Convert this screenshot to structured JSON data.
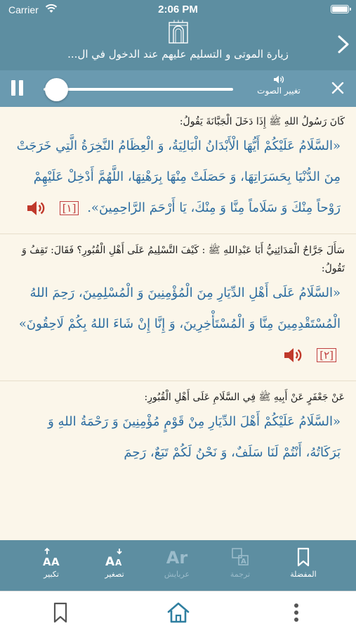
{
  "status": {
    "carrier": "Carrier",
    "time": "2:06 PM"
  },
  "header": {
    "title": "زيارة الموتى و التسليم عليهم عند الدخول في ال..."
  },
  "audio": {
    "volume_label": "تغيير الصوت",
    "progress": 0.07
  },
  "sections": [
    {
      "intro": "كَانَ رَسُولُ اللهِ ﷺ إِذَا دَخَلَ الْجَبَّانَةَ يَقُولُ:",
      "prayer": "«السَّلَامُ عَلَيْكُمْ أَيُّهَا الْأَبْدَانُ الْبَالِيَةُ، وَ الْعِظَامُ النَّخِرَةُ الَّتِي خَرَجَتْ مِنَ الدُّنْيَا بِحَسَرَاتِهَا، وَ حَصَلَتْ مِنْهَا بِرَهْنِهَا، اللَّهُمَّ أَدْخِلْ عَلَيْهِمْ رَوْحاً مِنْكَ وَ سَلَاماً مِنَّا وَ مِنْكَ، يَا أَرْحَمَ الرَّاحِمِينَ».",
      "ref": "[١]"
    },
    {
      "intro": "سَأَلَ جَرَّاحٌ الْمَدَائِنِيُّ أَبَا عَبْدِاللهِ ﷺ : كَيْفَ التَّسْلِيمُ عَلَى أَهْلِ الْقُبُورِ؟ فَقَالَ: تَقِفُ وَ تَقُولُ:",
      "prayer": "«السَّلَامُ عَلَى أَهْلِ الدِّيَارِ مِنَ الْمُؤْمِنِينَ وَ الْمُسْلِمِينَ، رَحِمَ اللهُ الْمُسْتَقْدِمِينَ مِنَّا وَ الْمُسْتَأْخِرِينَ، وَ إِنَّا إِنْ شَاءَ اللهُ بِكُمْ لَاحِقُونَ»",
      "ref": "[٢]"
    },
    {
      "intro": "عَنْ جَعْفَرٍ عَنْ أَبِيهِ ﷺ فِي السَّلَامِ عَلَى أَهْلِ الْقُبُورِ:",
      "prayer": "«السَّلَامُ عَلَيْكُمْ أَهْلَ الدِّيَارِ مِنْ قَوْمٍ مُؤْمِنِينَ وَ رَحْمَةُ اللهِ وَ بَرَكَاتُهُ، أَنْتُمْ لَنَا سَلَفٌ، وَ نَحْنُ لَكُمْ تَبَعٌ، رَحِمَ",
      "ref": ""
    }
  ],
  "toolbar": {
    "enlarge": {
      "glyph": "AA",
      "label": "تكبير"
    },
    "shrink": {
      "glyph": "AA",
      "label": "تصغير"
    },
    "arabic": {
      "glyph": "Ar",
      "label": "عربايش"
    },
    "translation": {
      "glyph": "A",
      "label": "ترجمة"
    },
    "favorite": {
      "label": "المفضلة"
    }
  },
  "colors": {
    "header": "#5d8ea1",
    "audio_bar": "#6a9ab0",
    "prayer_text": "#2c6ca0",
    "ref": "#c04040",
    "background": "#fbf6ea"
  }
}
